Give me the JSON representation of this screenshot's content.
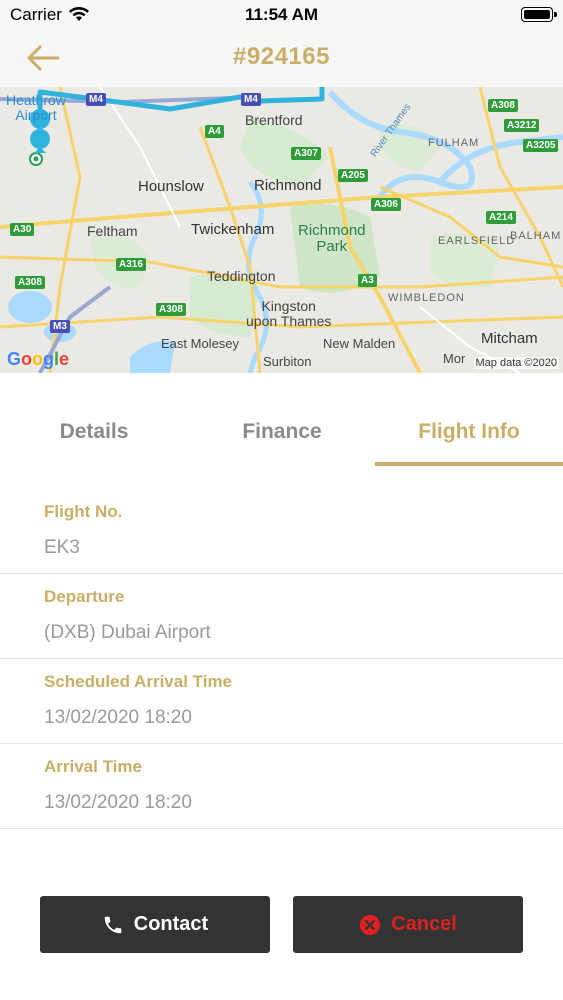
{
  "status_bar": {
    "carrier": "Carrier",
    "time": "11:54 AM"
  },
  "nav": {
    "title": "#924165",
    "back_icon": "arrow-left-icon"
  },
  "map": {
    "labels": {
      "heathrow": "Heathrow\nAirport",
      "brentford": "Brentford",
      "fulham": "FULHAM",
      "hounslow": "Hounslow",
      "richmond": "Richmond",
      "feltham": "Feltham",
      "twickenham": "Twickenham",
      "richmond_park": "Richmond\nPark",
      "earlsfield": "EARLSFIELD",
      "balham": "BALHAM",
      "teddington": "Teddington",
      "wimbledon": "WIMBLEDON",
      "kingston": "Kingston\nupon Thames",
      "mitcham": "Mitcham",
      "east_molesey": "East Molesey",
      "new_malden": "New Malden",
      "surbiton": "Surbiton",
      "morden": "Mor",
      "river_thames": "River Thames"
    },
    "roads": {
      "a4": "A4",
      "a308_top": "A308",
      "a3212": "A3212",
      "a3205": "A3205",
      "a307": "A307",
      "a205": "A205",
      "a306": "A306",
      "a30": "A30",
      "a214": "A214",
      "a316": "A316",
      "a308_left": "A308",
      "a3": "A3",
      "a308_bottom": "A308",
      "m3": "M3",
      "m4a": "M4",
      "m4b": "M4"
    },
    "google": "Google",
    "attribution": "Map data ©2020",
    "route_color": "#2fb3dc"
  },
  "tabs": [
    {
      "label": "Details",
      "active": false
    },
    {
      "label": "Finance",
      "active": false
    },
    {
      "label": "Flight Info",
      "active": true
    }
  ],
  "flight_info": [
    {
      "label": "Flight No.",
      "value": "EK3"
    },
    {
      "label": "Departure",
      "value": "(DXB) Dubai Airport"
    },
    {
      "label": "Scheduled Arrival Time",
      "value": "13/02/2020 18:20"
    },
    {
      "label": "Arrival Time",
      "value": "13/02/2020 18:20"
    }
  ],
  "actions": {
    "contact_label": "Contact",
    "contact_icon": "phone-icon",
    "cancel_label": "Cancel",
    "cancel_icon": "cancel-circle-icon"
  },
  "colors": {
    "accent": "#c9ae67",
    "button_bg": "#333333",
    "cancel_red": "#e02020"
  }
}
